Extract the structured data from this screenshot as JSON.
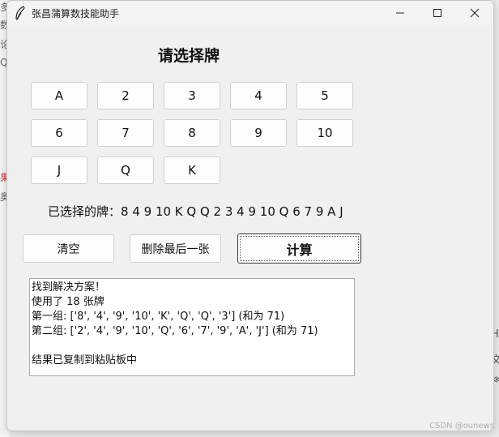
{
  "window": {
    "title": "张昌蒲算数技能助手",
    "icon": "feather-icon"
  },
  "titlebar_buttons": {
    "minimize": "minimize-icon",
    "maximize": "maximize-icon",
    "close": "close-icon"
  },
  "heading": "请选择牌",
  "cards": [
    "A",
    "2",
    "3",
    "4",
    "5",
    "6",
    "7",
    "8",
    "9",
    "10",
    "J",
    "Q",
    "K"
  ],
  "selection": {
    "label": "已选择的牌：",
    "value": "8 4 9 10 K Q Q 2 3 4 9 10 Q 6 7 9 A J"
  },
  "actions": {
    "clear": "清空",
    "delete_last": "删除最后一张",
    "calculate": "计算"
  },
  "output": {
    "lines": [
      "找到解决方案！",
      "使用了 18 张牌",
      "第一组: ['8', '4', '9', '10', 'K', 'Q', 'Q', '3'] (和为 71)",
      "第二组: ['2', '4', '9', '10', 'Q', '6', '7', '9', 'A', 'J'] (和为 71)",
      "",
      "结果已复制到粘贴板中"
    ]
  },
  "watermark": "CSDN @ounews"
}
